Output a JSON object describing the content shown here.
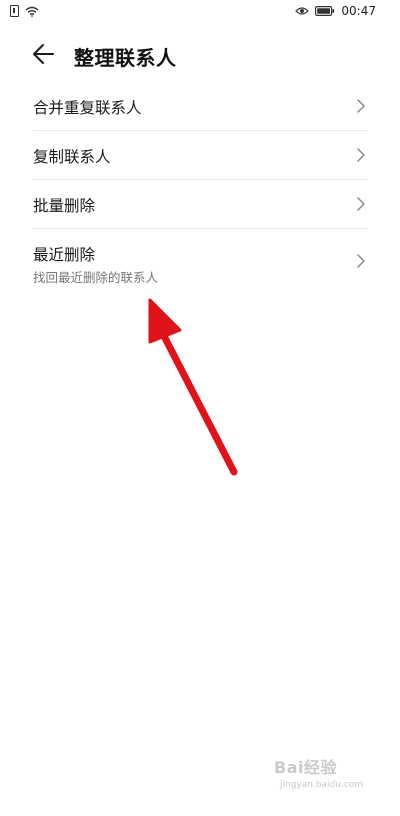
{
  "status_bar": {
    "time": "00:47",
    "icons": [
      "sim-icon",
      "wifi-icon",
      "eye-icon",
      "battery-icon"
    ]
  },
  "header": {
    "back_icon": "arrow-left-icon",
    "title": "整理联系人"
  },
  "menu": {
    "items": [
      {
        "label": "合并重复联系人",
        "sublabel": ""
      },
      {
        "label": "复制联系人",
        "sublabel": ""
      },
      {
        "label": "批量删除",
        "sublabel": ""
      },
      {
        "label": "最近删除",
        "sublabel": "找回最近删除的联系人"
      }
    ]
  },
  "annotation": {
    "arrow_color": "#e0131a"
  },
  "watermark": {
    "logo": "Bai经验",
    "sub": "jingyan.baidu.com"
  }
}
